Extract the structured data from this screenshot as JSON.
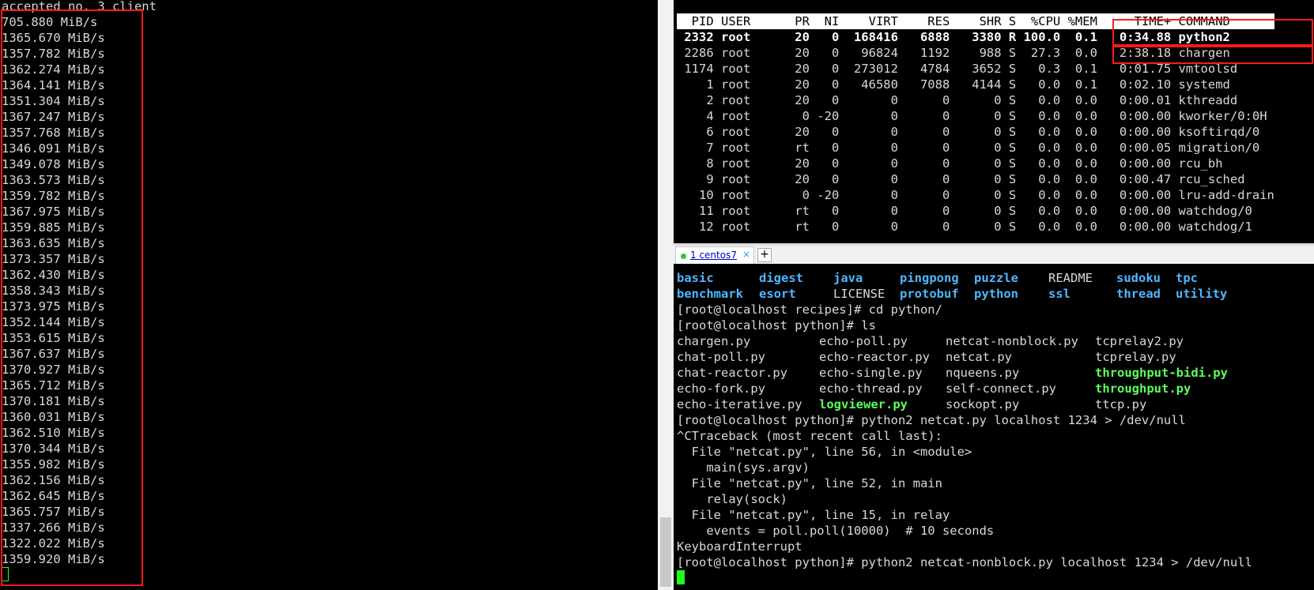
{
  "left_terminal": {
    "header": "accepted no. 3 client",
    "throughput_lines": [
      "705.880 MiB/s",
      "1365.670 MiB/s",
      "1357.782 MiB/s",
      "1362.274 MiB/s",
      "1364.141 MiB/s",
      "1351.304 MiB/s",
      "1367.247 MiB/s",
      "1357.768 MiB/s",
      "1346.091 MiB/s",
      "1349.078 MiB/s",
      "1363.573 MiB/s",
      "1359.782 MiB/s",
      "1367.975 MiB/s",
      "1359.885 MiB/s",
      "1363.635 MiB/s",
      "1373.357 MiB/s",
      "1362.430 MiB/s",
      "1358.343 MiB/s",
      "1373.975 MiB/s",
      "1352.144 MiB/s",
      "1353.615 MiB/s",
      "1367.637 MiB/s",
      "1370.927 MiB/s",
      "1365.712 MiB/s",
      "1370.181 MiB/s",
      "1360.031 MiB/s",
      "1362.510 MiB/s",
      "1370.344 MiB/s",
      "1355.982 MiB/s",
      "1362.156 MiB/s",
      "1362.645 MiB/s",
      "1365.757 MiB/s",
      "1337.266 MiB/s",
      "1322.022 MiB/s",
      "1359.920 MiB/s"
    ]
  },
  "top_view": {
    "header": "  PID USER      PR  NI    VIRT    RES    SHR S  %CPU %MEM     TIME+ COMMAND",
    "rows": [
      {
        "text": " 2332 root      20   0  168416   6888   3380 R 100.0  0.1   0:34.88 python2",
        "bold": true
      },
      {
        "text": " 2286 root      20   0   96824   1192    988 S  27.3  0.0   2:38.18 chargen",
        "bold": false
      },
      {
        "text": " 1174 root      20   0  273012   4784   3652 S   0.3  0.1   0:01.75 vmtoolsd",
        "bold": false
      },
      {
        "text": "    1 root      20   0   46580   7088   4144 S   0.0  0.1   0:02.10 systemd",
        "bold": false
      },
      {
        "text": "    2 root      20   0       0      0      0 S   0.0  0.0   0:00.01 kthreadd",
        "bold": false
      },
      {
        "text": "    4 root       0 -20       0      0      0 S   0.0  0.0   0:00.00 kworker/0:0H",
        "bold": false
      },
      {
        "text": "    6 root      20   0       0      0      0 S   0.0  0.0   0:00.00 ksoftirqd/0",
        "bold": false
      },
      {
        "text": "    7 root      rt   0       0      0      0 S   0.0  0.0   0:00.05 migration/0",
        "bold": false
      },
      {
        "text": "    8 root      20   0       0      0      0 S   0.0  0.0   0:00.00 rcu_bh",
        "bold": false
      },
      {
        "text": "    9 root      20   0       0      0      0 S   0.0  0.0   0:00.47 rcu_sched",
        "bold": false
      },
      {
        "text": "   10 root       0 -20       0      0      0 S   0.0  0.0   0:00.00 lru-add-drain",
        "bold": false
      },
      {
        "text": "   11 root      rt   0       0      0      0 S   0.0  0.0   0:00.00 watchdog/0",
        "bold": false
      },
      {
        "text": "   12 root      rt   0       0      0      0 S   0.0  0.0   0:00.00 watchdog/1",
        "bold": false
      }
    ]
  },
  "tabs": [
    {
      "label": "1 centos7",
      "close": "×"
    }
  ],
  "new_tab": "+",
  "shell": {
    "ls_dirs_row1": [
      {
        "t": "basic",
        "c": "dir"
      },
      {
        "t": "digest",
        "c": "dir"
      },
      {
        "t": "java",
        "c": "dir"
      },
      {
        "t": "pingpong",
        "c": "dir"
      },
      {
        "t": "puzzle",
        "c": "dir"
      },
      {
        "t": "README",
        "c": "plain"
      },
      {
        "t": "sudoku",
        "c": "dir"
      },
      {
        "t": "tpc",
        "c": "dir"
      }
    ],
    "ls_dirs_row2": [
      {
        "t": "benchmark",
        "c": "dir"
      },
      {
        "t": "esort",
        "c": "dir"
      },
      {
        "t": "LICENSE",
        "c": "plain"
      },
      {
        "t": "protobuf",
        "c": "dir"
      },
      {
        "t": "python",
        "c": "dir"
      },
      {
        "t": "ssl",
        "c": "dir"
      },
      {
        "t": "thread",
        "c": "dir"
      },
      {
        "t": "utility",
        "c": "dir"
      }
    ],
    "cmd1": "[root@localhost recipes]# cd python/",
    "cmd2": "[root@localhost python]# ls",
    "ls_files": [
      [
        {
          "t": "chargen.py",
          "c": "plain"
        },
        {
          "t": "echo-poll.py",
          "c": "plain"
        },
        {
          "t": "netcat-nonblock.py",
          "c": "plain"
        },
        {
          "t": "tcprelay2.py",
          "c": "plain"
        }
      ],
      [
        {
          "t": "chat-poll.py",
          "c": "plain"
        },
        {
          "t": "echo-reactor.py",
          "c": "plain"
        },
        {
          "t": "netcat.py",
          "c": "plain"
        },
        {
          "t": "tcprelay.py",
          "c": "plain"
        }
      ],
      [
        {
          "t": "chat-reactor.py",
          "c": "plain"
        },
        {
          "t": "echo-single.py",
          "c": "plain"
        },
        {
          "t": "nqueens.py",
          "c": "plain"
        },
        {
          "t": "throughput-bidi.py",
          "c": "exe"
        }
      ],
      [
        {
          "t": "echo-fork.py",
          "c": "plain"
        },
        {
          "t": "echo-thread.py",
          "c": "plain"
        },
        {
          "t": "self-connect.py",
          "c": "plain"
        },
        {
          "t": "throughput.py",
          "c": "exe"
        }
      ],
      [
        {
          "t": "echo-iterative.py",
          "c": "plain"
        },
        {
          "t": "logviewer.py",
          "c": "exe"
        },
        {
          "t": "sockopt.py",
          "c": "plain"
        },
        {
          "t": "ttcp.py",
          "c": "plain"
        }
      ]
    ],
    "trace_lines": [
      "[root@localhost python]# python2 netcat.py localhost 1234 > /dev/null",
      "^CTraceback (most recent call last):",
      "  File \"netcat.py\", line 56, in <module>",
      "    main(sys.argv)",
      "  File \"netcat.py\", line 52, in main",
      "    relay(sock)",
      "  File \"netcat.py\", line 15, in relay",
      "    events = poll.poll(10000)  # 10 seconds",
      "KeyboardInterrupt",
      "[root@localhost python]# python2 netcat-nonblock.py localhost 1234 > /dev/null"
    ]
  },
  "colors": {
    "highlight": "#ff1a1a",
    "cursor": "#1eff1e",
    "dir": "#4fb6ff",
    "exe": "#5cff5c"
  }
}
